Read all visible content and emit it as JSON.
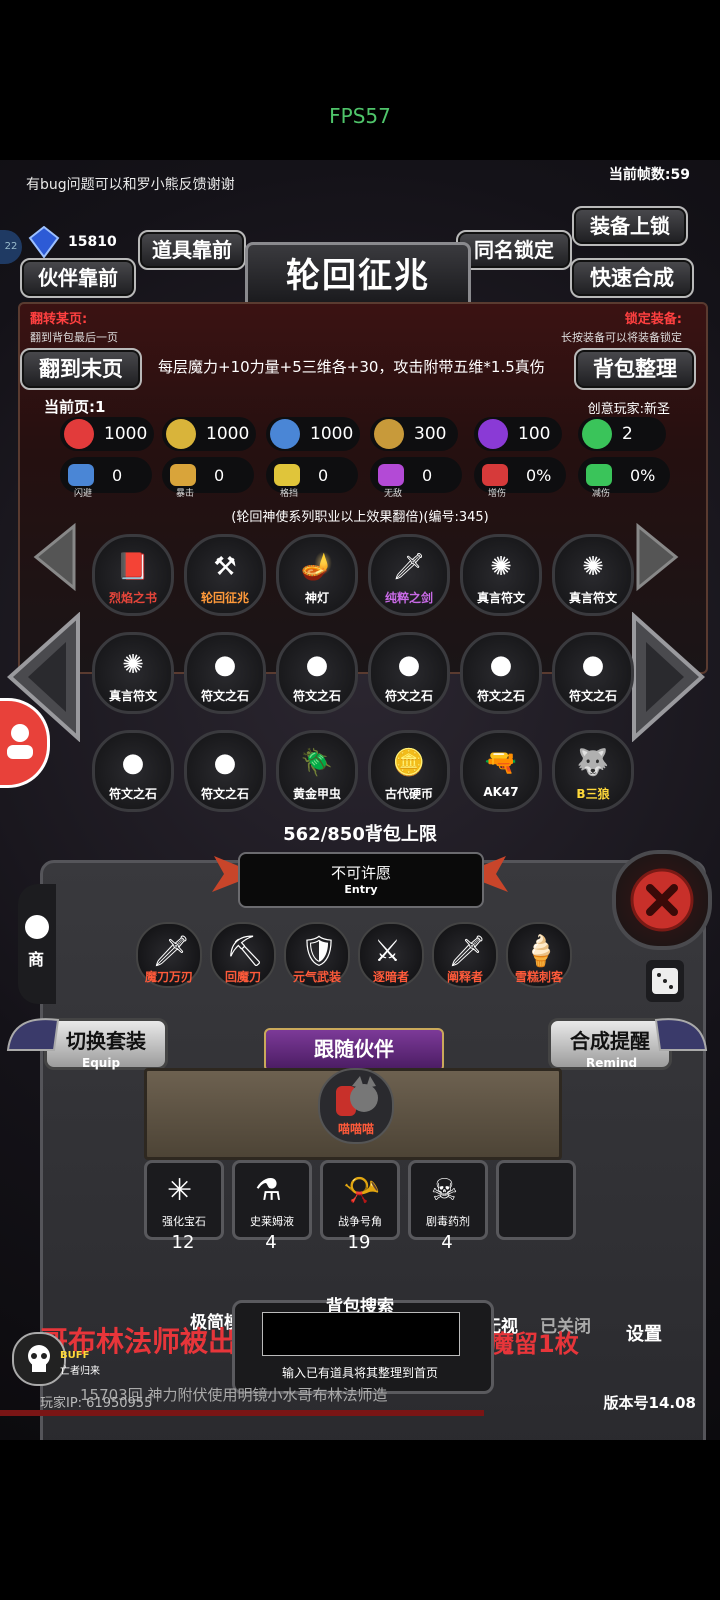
{
  "fps": "FPS57",
  "top_message": "有bug问题可以和罗小熊反馈谢谢",
  "frame_rate_label": "当前帧数:59",
  "currency": {
    "value": "15810",
    "badge": "22"
  },
  "buttons": {
    "equip_lock": "装备上锁",
    "item_front": "道具靠前",
    "same_name_lock": "同名锁定",
    "partner_front": "伙伴靠前",
    "quick_synth": "快速合成",
    "to_last_page": "翻到末页",
    "bag_sort": "背包整理"
  },
  "title": "轮回征兆",
  "flip_page": {
    "label": "翻转某页:",
    "hint": "翻到背包最后一页"
  },
  "lock_equip": {
    "label": "锁定装备:",
    "hint": "长按装备可以将装备锁定"
  },
  "description": "每层魔力+10力量+5三维各+30，攻击附带五维*1.5真伤",
  "current_page": "当前页:1",
  "creator": "创意玩家:新圣",
  "stats_row1": [
    {
      "icon": "heart-icon",
      "value": "1000",
      "color": "#e23b3b"
    },
    {
      "icon": "armor-icon",
      "value": "1000",
      "color": "#d9b43a"
    },
    {
      "icon": "helmet-icon",
      "value": "1000",
      "color": "#4a86d6"
    },
    {
      "icon": "sword-icon",
      "value": "300",
      "color": "#c89a3a"
    },
    {
      "icon": "lightning-icon",
      "value": "100",
      "color": "#8a3ad6"
    },
    {
      "icon": "clover-icon",
      "value": "2",
      "color": "#3ac45a"
    }
  ],
  "stats_row2": [
    {
      "icon": "dodge-icon",
      "label": "闪避",
      "value": "0",
      "color": "#4a86d6"
    },
    {
      "icon": "crit-icon",
      "label": "暴击",
      "value": "0",
      "color": "#d9a43a"
    },
    {
      "icon": "block-icon",
      "label": "格挡",
      "value": "0",
      "color": "#e0c53a"
    },
    {
      "icon": "invincible-icon",
      "label": "无敌",
      "value": "0",
      "color": "#b34ad6"
    },
    {
      "icon": "damage-up-icon",
      "label": "增伤",
      "value": "0%",
      "color": "#d63a3a"
    },
    {
      "icon": "damage-down-icon",
      "label": "减伤",
      "value": "0%",
      "color": "#3ac45a"
    }
  ],
  "note": "(轮回神使系列职业以上效果翻倍)(编号:345)",
  "inventory": [
    {
      "name": "烈焰之书",
      "color": "#e6453a",
      "glyph": "📕"
    },
    {
      "name": "轮回征兆",
      "color": "#ff9a3a",
      "glyph": "⚒"
    },
    {
      "name": "神灯",
      "color": "#ffffff",
      "glyph": "🪔"
    },
    {
      "name": "纯粹之剑",
      "color": "#c86ae6",
      "glyph": "🗡"
    },
    {
      "name": "真言符文",
      "color": "#ffffff",
      "glyph": "✺"
    },
    {
      "name": "真言符文",
      "color": "#ffffff",
      "glyph": "✺"
    },
    {
      "name": "真言符文",
      "color": "#ffffff",
      "glyph": "✺"
    },
    {
      "name": "符文之石",
      "color": "#ffffff",
      "glyph": "●"
    },
    {
      "name": "符文之石",
      "color": "#ffffff",
      "glyph": "●"
    },
    {
      "name": "符文之石",
      "color": "#ffffff",
      "glyph": "●"
    },
    {
      "name": "符文之石",
      "color": "#ffffff",
      "glyph": "●"
    },
    {
      "name": "符文之石",
      "color": "#ffffff",
      "glyph": "●"
    },
    {
      "name": "符文之石",
      "color": "#ffffff",
      "glyph": "●"
    },
    {
      "name": "符文之石",
      "color": "#ffffff",
      "glyph": "●"
    },
    {
      "name": "黄金甲虫",
      "color": "#ffffff",
      "glyph": "🪲"
    },
    {
      "name": "古代硬币",
      "color": "#ffffff",
      "glyph": "🪙"
    },
    {
      "name": "AK47",
      "color": "#ffffff",
      "glyph": "🔫"
    },
    {
      "name": "B三狼",
      "color": "#ffd93a",
      "glyph": "🐺"
    }
  ],
  "bag_capacity": "562/850背包上限",
  "entry": {
    "title": "不可许愿",
    "sub": "Entry"
  },
  "equipment": [
    {
      "name": "魔刀万刃",
      "glyph": "🗡"
    },
    {
      "name": "回魔刀",
      "glyph": "⛏"
    },
    {
      "name": "元气武装",
      "glyph": "🛡"
    },
    {
      "name": "逐暗者",
      "glyph": "⚔"
    },
    {
      "name": "阐释者",
      "glyph": "🗡"
    },
    {
      "name": "雪糕刺客",
      "glyph": "🍦"
    }
  ],
  "switch_set": {
    "label": "切换套装",
    "sub": "Equip"
  },
  "synth_remind": {
    "label": "合成提醒",
    "sub": "Remind"
  },
  "follow_partner": "跟随伙伴",
  "pet_name": "喵喵喵",
  "consumables": [
    {
      "name": "强化宝石",
      "count": "12",
      "glyph": "✳"
    },
    {
      "name": "史莱姆液",
      "count": "4",
      "glyph": "⚗"
    },
    {
      "name": "战争号角",
      "count": "19",
      "glyph": "📯"
    },
    {
      "name": "剧毒药剂",
      "count": "4",
      "glyph": "☠"
    },
    {
      "name": "",
      "count": "",
      "glyph": ""
    }
  ],
  "shop_label": "商",
  "search": {
    "title": "背包搜索",
    "hint": "输入已有道具将其整理到首页"
  },
  "side_labels": {
    "minimal": "极简模",
    "invisible": "无视",
    "closed": "已关闭",
    "settings": "设置"
  },
  "buff": {
    "label": "BUFF",
    "sub": "亡者归来"
  },
  "scroll_text": "哥布林法师被出",
  "scroll_text2": "魔留1枚",
  "scroll_text3": "15703回 神力附伏使用明镜小水哥布林法师造",
  "player_ip": "玩家IP: 61950955",
  "version": "版本号14.08"
}
